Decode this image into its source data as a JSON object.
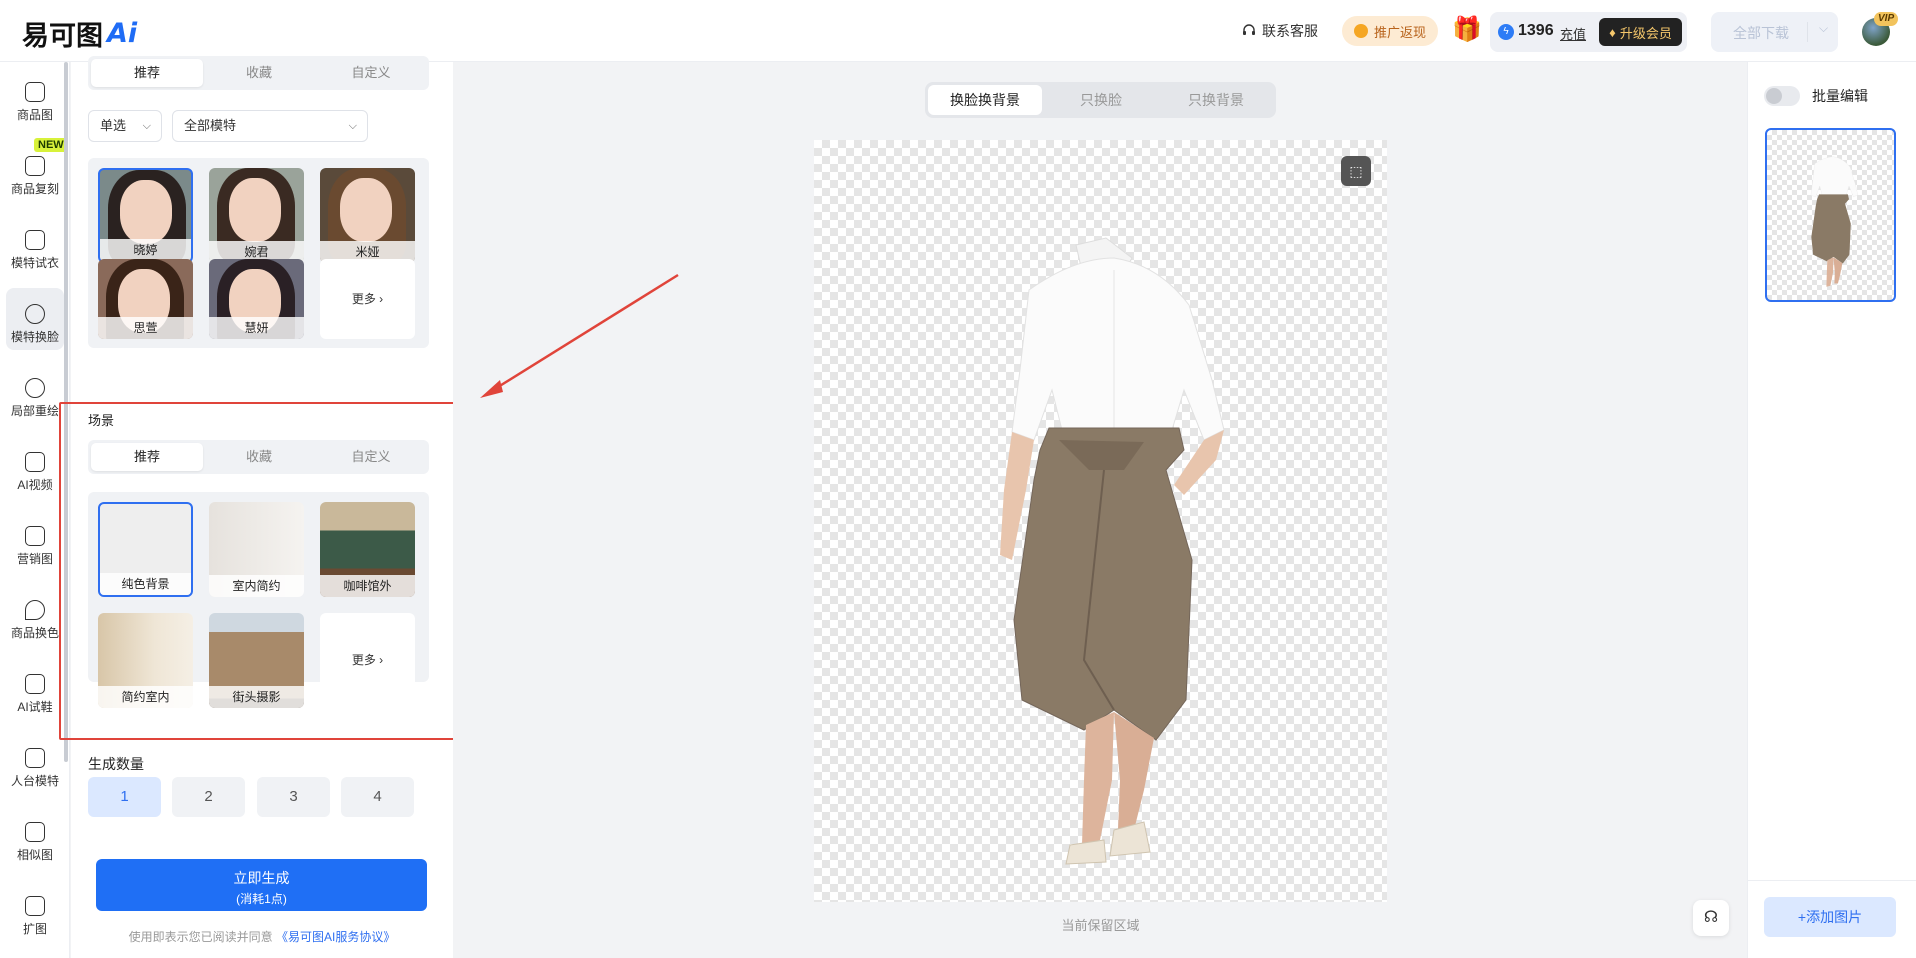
{
  "header": {
    "logo": {
      "text": "易可图",
      "ai": "Ai"
    },
    "contact_label": "联系客服",
    "promo_label": "推广返现",
    "credits": "1396",
    "recharge_label": "充值",
    "upgrade_label": "升级会员",
    "download_all_label": "全部下载",
    "vip_badge": "VIP"
  },
  "sidebar": {
    "items": [
      {
        "label": "商品图",
        "icon": "bag-icon"
      },
      {
        "label": "商品复刻",
        "icon": "copy-bag-icon",
        "badge": "NEW"
      },
      {
        "label": "模特试衣",
        "icon": "tshirt-icon"
      },
      {
        "label": "模特换脸",
        "icon": "face-icon",
        "active": true
      },
      {
        "label": "局部重绘",
        "icon": "face-edit-icon"
      },
      {
        "label": "AI视频",
        "icon": "video-icon"
      },
      {
        "label": "营销图",
        "icon": "poster-icon"
      },
      {
        "label": "商品换色",
        "icon": "drop-icon"
      },
      {
        "label": "AI试鞋",
        "icon": "shoe-icon"
      },
      {
        "label": "人台模特",
        "icon": "mannequin-icon"
      },
      {
        "label": "相似图",
        "icon": "image-icon"
      },
      {
        "label": "扩图",
        "icon": "expand-icon"
      }
    ]
  },
  "model_section": {
    "tabs": [
      "推荐",
      "收藏",
      "自定义"
    ],
    "select_mode": "单选",
    "select_type": "全部模特",
    "models": [
      "晓婷",
      "婉君",
      "米娅",
      "思萱",
      "慧妍"
    ],
    "more_label": "更多"
  },
  "scene_section": {
    "title": "场景",
    "tabs": [
      "推荐",
      "收藏",
      "自定义"
    ],
    "scenes": [
      "纯色背景",
      "室内简约",
      "咖啡馆外",
      "简约室内",
      "街头摄影"
    ],
    "more_label": "更多"
  },
  "quantity": {
    "label": "生成数量",
    "options": [
      "1",
      "2",
      "3",
      "4"
    ],
    "selected": "1"
  },
  "generate": {
    "label": "立即生成",
    "cost": "(消耗1点)"
  },
  "agreement": {
    "text": "使用即表示您已阅读并同意",
    "link": "《易可图AI服务协议》"
  },
  "canvas": {
    "mode_tabs": [
      "换脸换背景",
      "只换脸",
      "只换背景"
    ],
    "active_mode": "换脸换背景",
    "caption": "当前保留区域"
  },
  "right_panel": {
    "batch_label": "批量编辑",
    "add_image_label": "+添加图片"
  },
  "colors": {
    "accent": "#1f6ff5",
    "highlight_box": "#e0443a",
    "vip_gold": "#f5c76b"
  }
}
